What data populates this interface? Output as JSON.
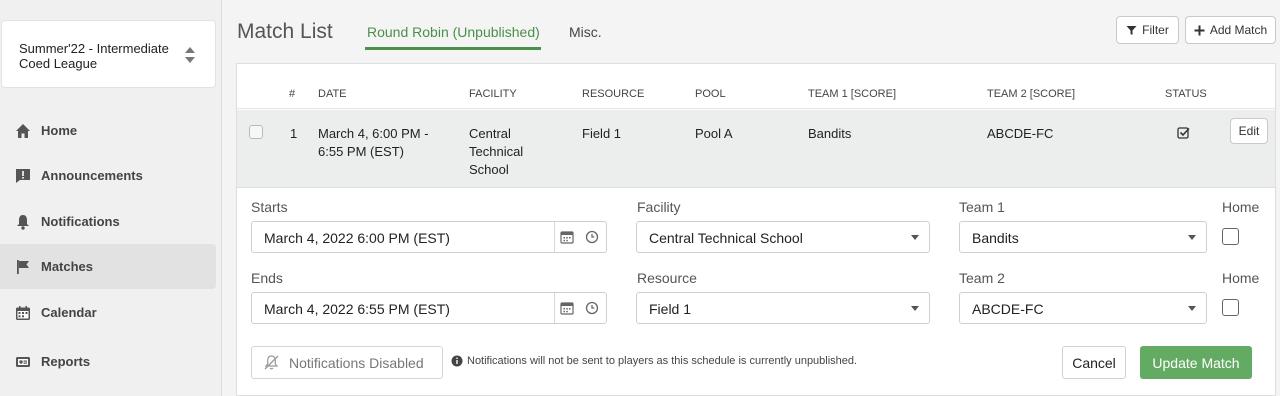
{
  "sidebar": {
    "league": "Summer'22 -  Intermediate Coed League",
    "items": [
      {
        "label": "Home",
        "icon": "home-icon"
      },
      {
        "label": "Announcements",
        "icon": "announcement-icon"
      },
      {
        "label": "Notifications",
        "icon": "bell-icon"
      },
      {
        "label": "Matches",
        "icon": "flag-icon",
        "active": true
      },
      {
        "label": "Calendar",
        "icon": "calendar-icon"
      },
      {
        "label": "Reports",
        "icon": "reports-icon"
      }
    ]
  },
  "header": {
    "title": "Match List",
    "tabs": [
      "Round Robin (Unpublished)",
      "Misc."
    ],
    "filter_label": "Filter",
    "add_label": "Add Match"
  },
  "table": {
    "columns": [
      "#",
      "DATE",
      "FACILITY",
      "RESOURCE",
      "POOL",
      "TEAM 1 [SCORE]",
      "TEAM 2 [SCORE]",
      "STATUS"
    ],
    "row": {
      "num": "1",
      "date": "March 4, 6:00 PM - 6:55 PM (EST)",
      "facility": "Central Technical School",
      "resource": "Field 1",
      "pool": "Pool A",
      "team1": "Bandits",
      "team2": "ABCDE-FC",
      "edit_label": "Edit"
    }
  },
  "form": {
    "starts_label": "Starts",
    "starts_value": "March 4, 2022 6:00 PM (EST)",
    "ends_label": "Ends",
    "ends_value": "March 4, 2022 6:55 PM (EST)",
    "facility_label": "Facility",
    "facility_value": "Central Technical School",
    "resource_label": "Resource",
    "resource_value": "Field 1",
    "team1_label": "Team 1",
    "team1_value": "Bandits",
    "team2_label": "Team 2",
    "team2_value": "ABCDE-FC",
    "home_label": "Home",
    "notifications_disabled": "Notifications Disabled",
    "info_text": "Notifications will not be sent to players as this schedule is currently unpublished.",
    "cancel_label": "Cancel",
    "update_label": "Update Match"
  },
  "colors": {
    "accent": "#4a8f4a",
    "update_button": "#63aa63"
  }
}
